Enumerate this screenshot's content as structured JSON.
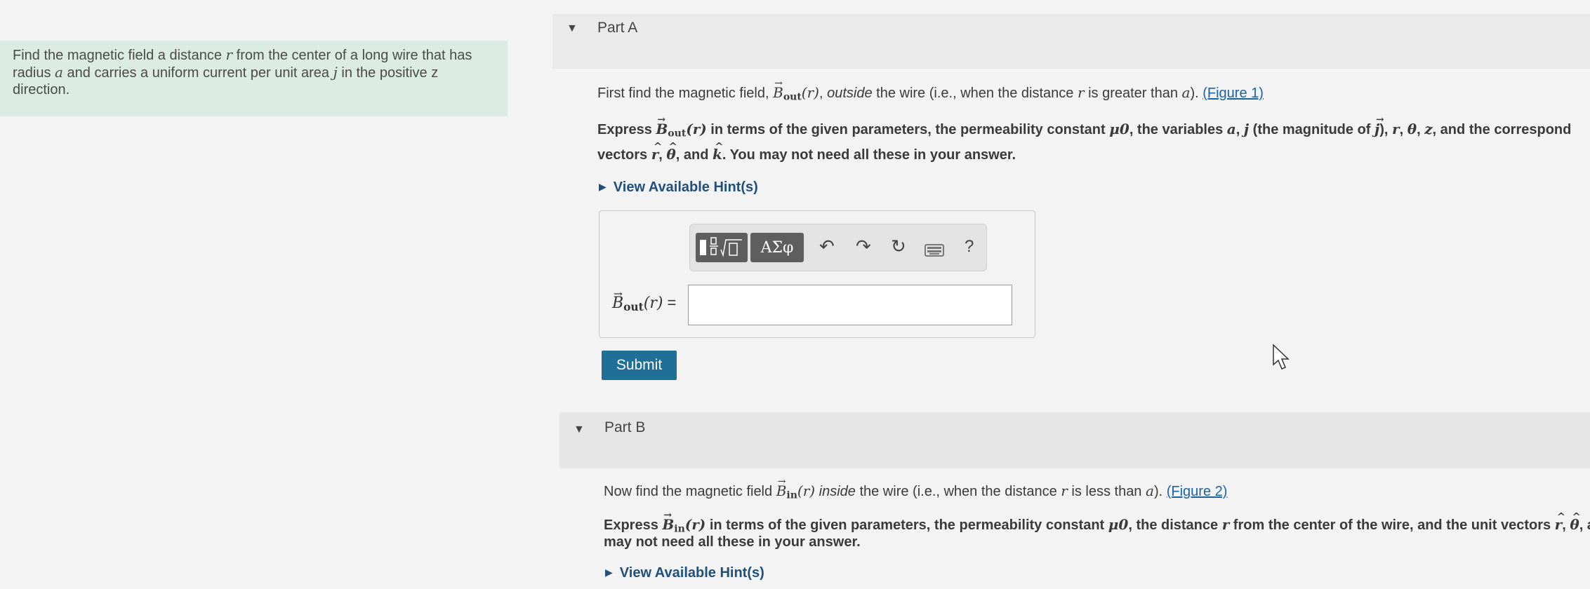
{
  "problem": {
    "text1": "Find the magnetic field a distance ",
    "var_r": "r",
    "text2": " from the center of a long wire that has radius ",
    "var_a": "a",
    "text3": " and carries a uniform current per unit area ",
    "var_j": "j",
    "text4": " in the positive z direction."
  },
  "partA": {
    "label": "Part A",
    "l1_a": "First find the magnetic field, ",
    "B": "B",
    "sub_out": "out",
    "arg": "(r)",
    "l1_b": ", ",
    "l1_italic": "outside",
    "l1_c": " the wire (i.e., when the distance ",
    "l1_d": " is greater than ",
    "l1_e": "). ",
    "figure_link": "(Figure 1)",
    "l2_a": "Express ",
    "l2_b": " in terms of the given parameters, the permeability constant ",
    "mu0": "μ0",
    "l2_c": ", the variables ",
    "l2_d": " (the magnitude of ",
    "l2_e": "), ",
    "theta": "θ",
    "z": "z",
    "l2_f": ", and the correspond",
    "l3_a": "vectors ",
    "k": "k",
    "l3_b": ", and ",
    "l3_c": ". You may not need all these in your answer.",
    "comma": ", ",
    "hint": "View Available Hint(s)",
    "answer_label_eq": " =",
    "submit": "Submit",
    "toolbar": {
      "greek": "ΑΣφ",
      "help": "?"
    }
  },
  "partB": {
    "label": "Part B",
    "l1_a": "Now find the magnetic field ",
    "sub_in": "in",
    "l1_italic": "inside",
    "l1_b": " the wire (i.e., when the distance ",
    "l1_c": " is less than ",
    "l1_d": "). ",
    "figure_link": "(Figure 2)",
    "l2_a": "Express ",
    "l2_b": " in terms of the given parameters, the permeability constant ",
    "l2_c": ", the distance ",
    "l2_d": " from the center of the wire, and the unit vectors ",
    "l2_e": ", and ",
    "l3": "may not need all these in your answer.",
    "hint": "View Available Hint(s)"
  }
}
